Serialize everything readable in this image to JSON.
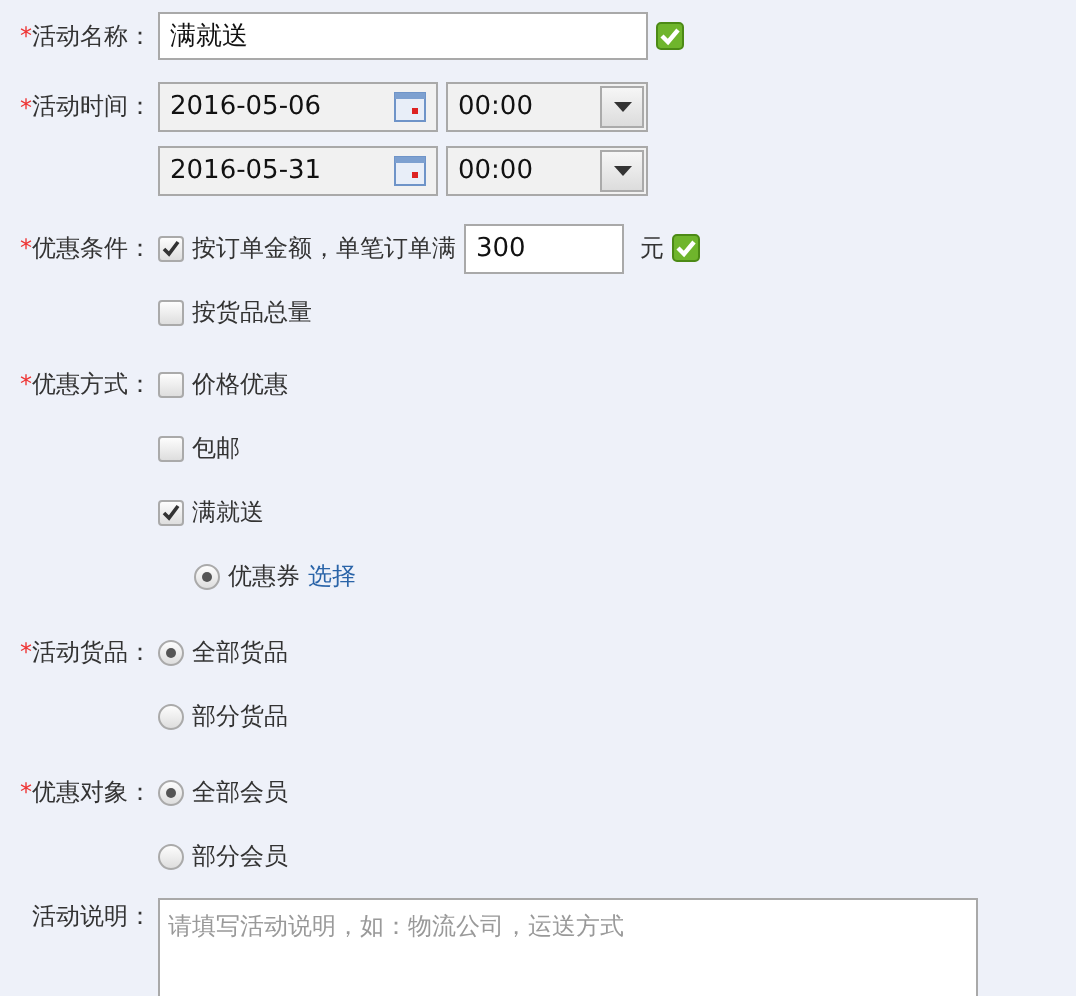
{
  "form": [
    {
      "kind": "text",
      "required_mark": "*",
      "label": "活动名称：",
      "value": "满就送",
      "valid": true
    },
    {
      "kind": "datetime",
      "required_mark": "*",
      "label": "活动时间：",
      "ranges": [
        {
          "date": "2016-05-06",
          "time": "00:00"
        },
        {
          "date": "2016-05-31",
          "time": "00:00"
        }
      ]
    },
    {
      "kind": "checks",
      "required_mark": "*",
      "label": "优惠条件：",
      "options": [
        {
          "label": "按订单金额，单笔订单满",
          "checked": true,
          "amount": "300",
          "unit": "元",
          "valid": true
        },
        {
          "label": "按货品总量",
          "checked": false
        }
      ]
    },
    {
      "kind": "checks",
      "required_mark": "*",
      "label": "优惠方式：",
      "options": [
        {
          "label": "价格优惠",
          "checked": false
        },
        {
          "label": "包邮",
          "checked": false
        },
        {
          "label": "满就送",
          "checked": true,
          "sub": {
            "label": "优惠券",
            "selected": true,
            "link": "选择"
          }
        }
      ]
    },
    {
      "kind": "radios",
      "required_mark": "*",
      "label": "活动货品：",
      "options": [
        {
          "label": "全部货品",
          "selected": true
        },
        {
          "label": "部分货品",
          "selected": false
        }
      ]
    },
    {
      "kind": "radios",
      "required_mark": "*",
      "label": "优惠对象：",
      "options": [
        {
          "label": "全部会员",
          "selected": true
        },
        {
          "label": "部分会员",
          "selected": false
        }
      ]
    },
    {
      "kind": "textarea",
      "label": "活动说明：",
      "placeholder": "请填写活动说明，如：物流公司，运送方式"
    }
  ]
}
